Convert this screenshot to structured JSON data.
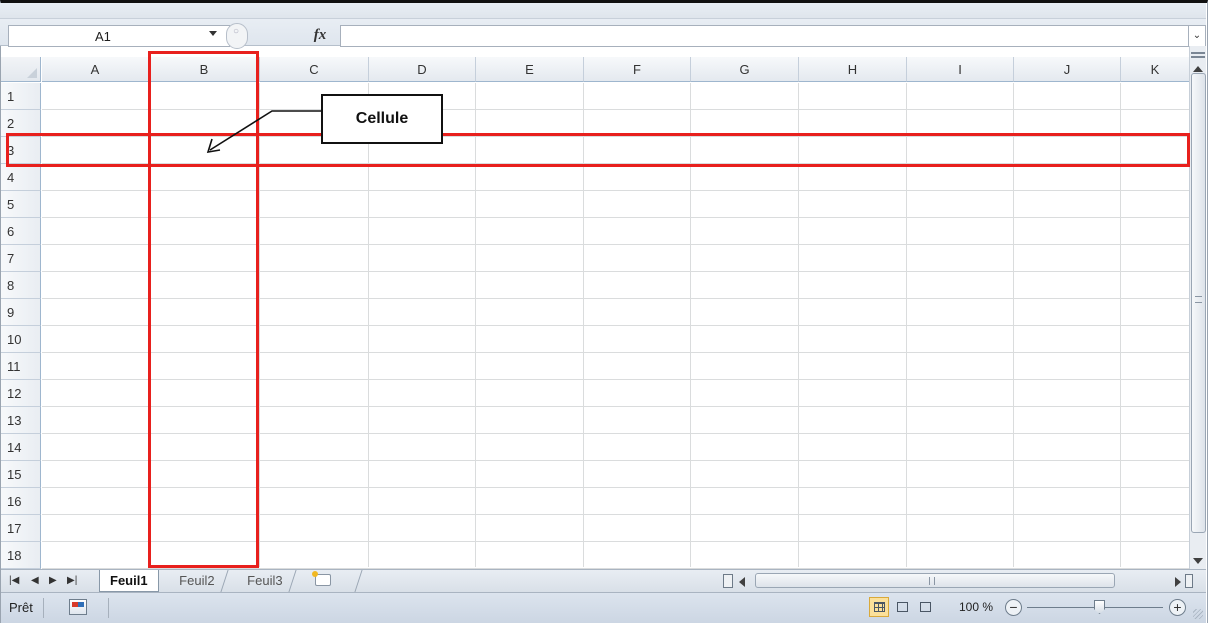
{
  "formula_bar": {
    "name_box": "A1",
    "fx_label": "fx",
    "formula": ""
  },
  "grid": {
    "columns": [
      "A",
      "B",
      "C",
      "D",
      "E",
      "F",
      "G",
      "H",
      "I",
      "J",
      "K"
    ],
    "rows": [
      "1",
      "2",
      "3",
      "4",
      "5",
      "6",
      "7",
      "8",
      "9",
      "10",
      "11",
      "12",
      "13",
      "14",
      "15",
      "16",
      "17",
      "18"
    ]
  },
  "sheet_tabs": [
    "Feuil1",
    "Feuil2",
    "Feuil3"
  ],
  "active_sheet": "Feuil1",
  "status_bar": {
    "ready": "Prêt",
    "zoom": "100 %",
    "zoom_minus": "−",
    "zoom_plus": "+"
  },
  "annotation": {
    "callout": "Cellule",
    "highlighted_column": "B",
    "highlighted_row": "3",
    "highlight_color": "#e8201d"
  }
}
